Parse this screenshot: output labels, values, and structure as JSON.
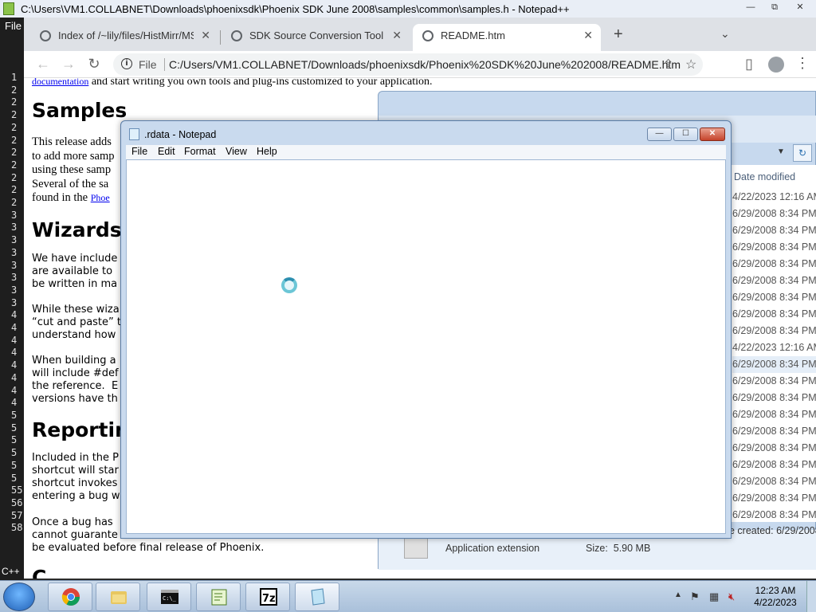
{
  "npp": {
    "title": "C:\\Users\\VM1.COLLABNET\\Downloads\\phoenixsdk\\Phoenix SDK June 2008\\samples\\common\\samples.h - Notepad++",
    "menu_file": "File",
    "line_numbers": [
      "1",
      "2",
      "2",
      "2",
      "2",
      "2",
      "2",
      "2",
      "2",
      "2",
      "2",
      "3",
      "3",
      "3",
      "3",
      "3",
      "3",
      "3",
      "3",
      "4",
      "4",
      "4",
      "4",
      "4",
      "4",
      "4",
      "4",
      "5",
      "5",
      "5",
      "5",
      "5",
      "5",
      "55",
      "56",
      "57",
      "58"
    ],
    "lang": "C++"
  },
  "chrome": {
    "tabs": [
      {
        "label": "Index of /~lily/files/HistMirr/MSF",
        "close": "✕"
      },
      {
        "label": "SDK Source Conversion Tool",
        "close": "✕"
      },
      {
        "label": "README.htm",
        "close": "✕"
      }
    ],
    "new_tab": "+",
    "tab_search": "⌄",
    "address": {
      "scheme": "File",
      "url": "C:/Users/VM1.COLLABNET/Downloads/phoenixsdk/Phoenix%20SDK%20June%202008/README.htm"
    },
    "page": {
      "top_line_link": "documentation",
      "top_line": " and start writing you own tools and plug-ins customized to your application.",
      "samples_heading": "Samples",
      "samples_text": "This release adds\nto add more samp\nusing these samp\nSeveral of the sa\nfound in the ",
      "samples_link": "Phoe",
      "wizards_heading": "Wizards",
      "wizards_p1": "We have include\nare available to \nbe written in ma",
      "wizards_p2": "While these wiza\n“cut and paste” t\nunderstand how",
      "wizards_p3": "When building a\nwill include #def\nthe reference.  E\nversions have th",
      "reporting_heading": "Reportin",
      "reporting_p1": "Included in the P\nshortcut will star\nshortcut invokes\nentering a bug w",
      "reporting_p2_a": "Once a bug has",
      "reporting_p2_b": "cannot guarante",
      "reporting_p2_c": "be evaluated before final release of Phoenix.",
      "next_heading": "C"
    }
  },
  "explorer": {
    "column_header": "Date modified",
    "dates": [
      "4/22/2023 12:16 AM",
      "6/29/2008 8:34 PM",
      "6/29/2008 8:34 PM",
      "6/29/2008 8:34 PM",
      "6/29/2008 8:34 PM",
      "6/29/2008 8:34 PM",
      "6/29/2008 8:34 PM",
      "6/29/2008 8:34 PM",
      "6/29/2008 8:34 PM",
      "4/22/2023 12:16 AM",
      "6/29/2008 8:34 PM",
      "6/29/2008 8:34 PM",
      "6/29/2008 8:34 PM",
      "6/29/2008 8:34 PM",
      "6/29/2008 8:34 PM",
      "6/29/2008 8:34 PM",
      "6/29/2008 8:34 PM",
      "6/29/2008 8:34 PM",
      "6/29/2008 8:34 PM",
      "6/29/2008 8:34 PM"
    ],
    "highlighted_row": 10,
    "details": {
      "type": "Application extension",
      "size_label": "Size:",
      "size_value": "5.90 MB",
      "created": "e created:  6/29/2008"
    }
  },
  "notepad": {
    "title": ".rdata - Notepad",
    "menus": [
      "File",
      "Edit",
      "Format",
      "View",
      "Help"
    ],
    "controls": {
      "minimize": "—",
      "maximize": "☐",
      "close": "✕"
    }
  },
  "taskbar": {
    "apps": [
      "chrome-icon",
      "explorer-icon",
      "cmd-icon",
      "notepadpp-icon",
      "7zip-icon",
      "notepad-icon"
    ],
    "app_labels": {
      "cmd": "C:\\_",
      "sevenzip": "7z"
    },
    "clock_time": "12:23 AM",
    "clock_date": "4/22/2023"
  }
}
